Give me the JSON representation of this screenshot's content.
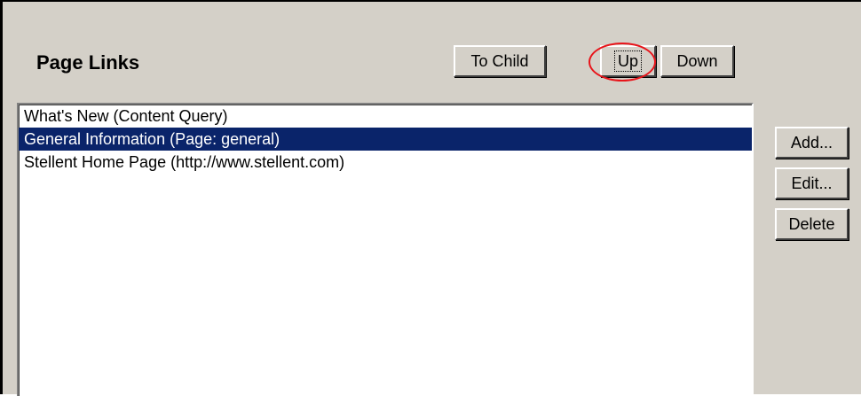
{
  "panel": {
    "title": "Page Links"
  },
  "toolbar": {
    "to_child_label": "To Child",
    "up_label": "Up",
    "down_label": "Down"
  },
  "side_buttons": {
    "add_label": "Add...",
    "edit_label": "Edit...",
    "delete_label": "Delete"
  },
  "links_list": {
    "items": [
      {
        "label": "What's New (Content Query)",
        "selected": false
      },
      {
        "label": "General Information (Page: general)",
        "selected": true
      },
      {
        "label": "Stellent Home Page (http://www.stellent.com)",
        "selected": false
      }
    ]
  },
  "colors": {
    "selection_bg": "#0a246a",
    "annotation": "#e8141a",
    "window_bg": "#d4d0c8"
  },
  "icons": {
    "annotation": "red-ellipse-highlight"
  }
}
